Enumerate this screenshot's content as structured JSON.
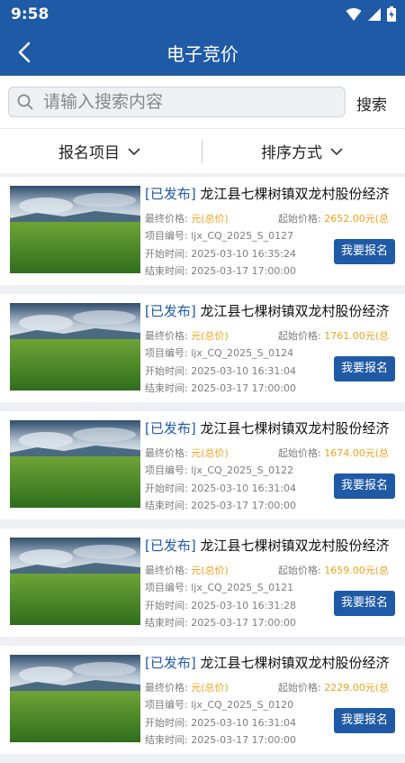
{
  "status_bar": {
    "time": "9:58"
  },
  "app_bar": {
    "title": "电子竞价"
  },
  "search": {
    "placeholder": "请输入搜索内容",
    "button_label": "搜索"
  },
  "filters": {
    "signup_label": "报名项目",
    "sort_label": "排序方式"
  },
  "labels": {
    "final_price": "最终价格:",
    "start_price": "起始价格:",
    "project_no": "项目编号:",
    "start_time": "开始时间:",
    "end_time": "结束时间:",
    "sign_button": "我要报名"
  },
  "colors": {
    "primary": "#1f5aa6",
    "price": "#f0a21a"
  },
  "items": [
    {
      "status": "[已发布]",
      "title": "龙江县七棵树镇双龙村股份经济",
      "final_price": "元(总价)",
      "start_price": "2652.00元(总",
      "project_no": "ljx_CQ_2025_S_0127",
      "start_time": "2025-03-10 16:35:24",
      "end_time": "2025-03-17 17:00:00"
    },
    {
      "status": "[已发布]",
      "title": "龙江县七棵树镇双龙村股份经济",
      "final_price": "元(总价)",
      "start_price": "1761.00元(总",
      "project_no": "ljx_CQ_2025_S_0124",
      "start_time": "2025-03-10 16:31:04",
      "end_time": "2025-03-17 17:00:00"
    },
    {
      "status": "[已发布]",
      "title": "龙江县七棵树镇双龙村股份经济",
      "final_price": "元(总价)",
      "start_price": "1674.00元(总",
      "project_no": "ljx_CQ_2025_S_0122",
      "start_time": "2025-03-10 16:31:04",
      "end_time": "2025-03-17 17:00:00"
    },
    {
      "status": "[已发布]",
      "title": "龙江县七棵树镇双龙村股份经济",
      "final_price": "元(总价)",
      "start_price": "1659.00元(总",
      "project_no": "ljx_CQ_2025_S_0121",
      "start_time": "2025-03-10 16:31:28",
      "end_time": "2025-03-17 17:00:00"
    },
    {
      "status": "[已发布]",
      "title": "龙江县七棵树镇双龙村股份经济",
      "final_price": "元(总价)",
      "start_price": "2229.00元(总",
      "project_no": "ljx_CQ_2025_S_0120",
      "start_time": "2025-03-10 16:31:04",
      "end_time": "2025-03-17 17:00:00"
    }
  ]
}
